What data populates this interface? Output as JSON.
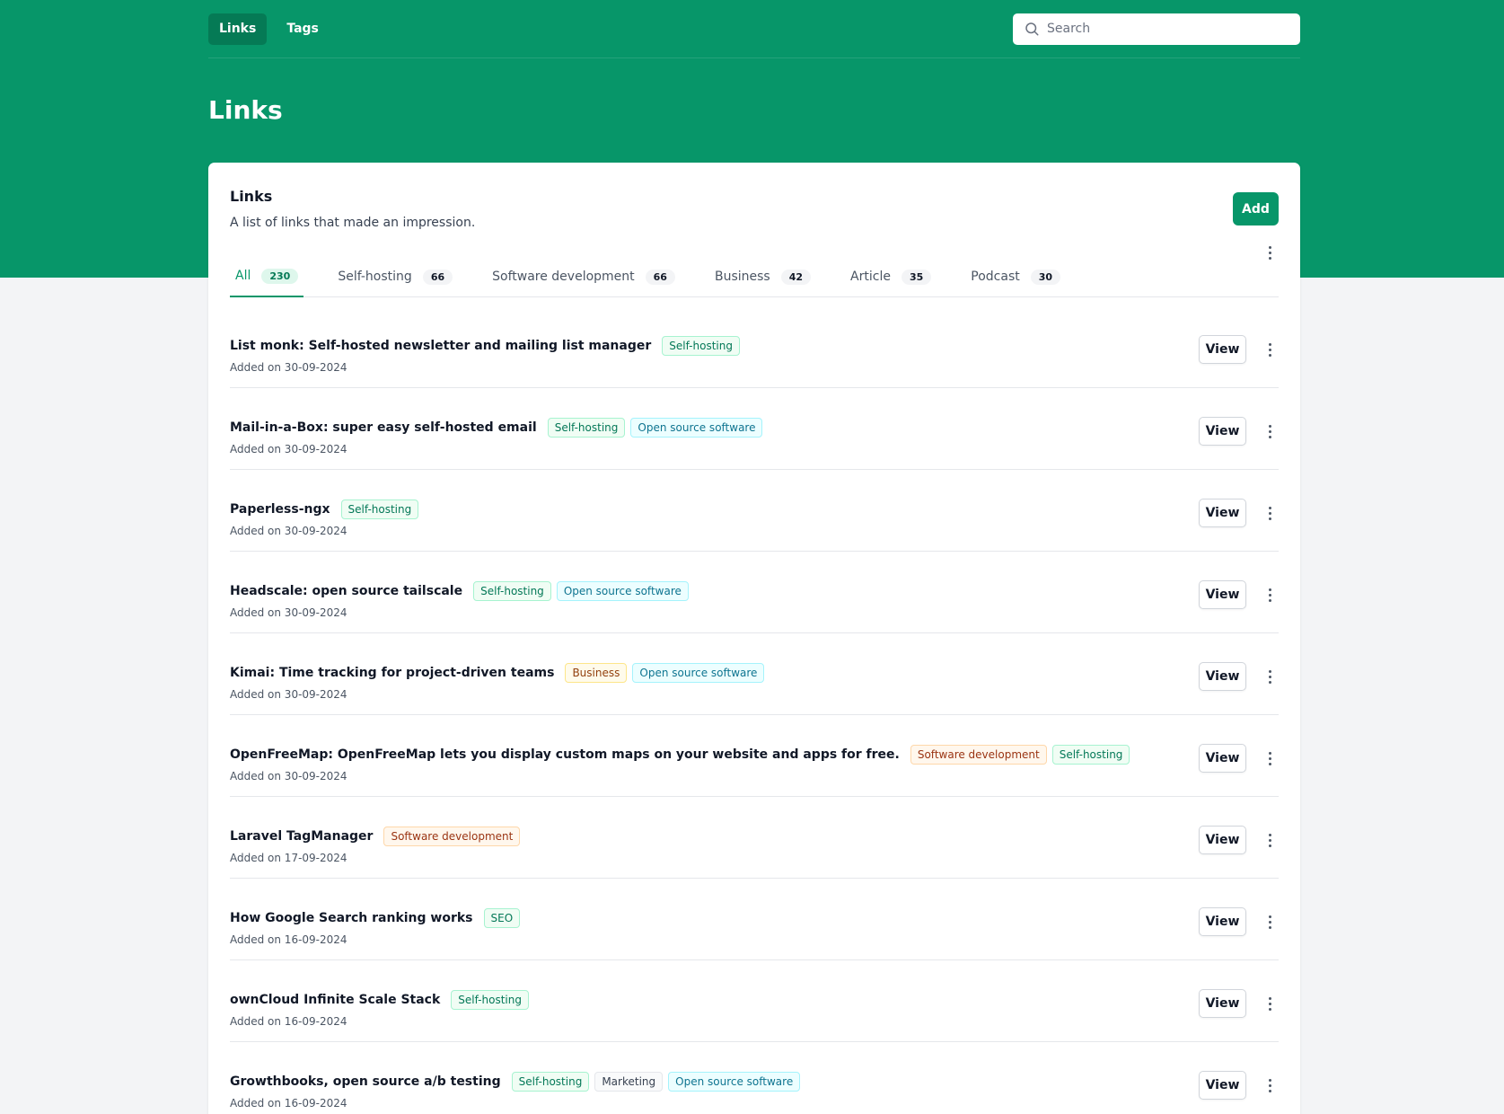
{
  "nav": {
    "items": [
      {
        "label": "Links",
        "active": true
      },
      {
        "label": "Tags",
        "active": false
      }
    ]
  },
  "search": {
    "placeholder": "Search",
    "value": ""
  },
  "page_title": "Links",
  "card": {
    "title": "Links",
    "description": "A list of links that made an impression.",
    "add_label": "Add"
  },
  "tabs": [
    {
      "label": "All",
      "count": "230",
      "active": true
    },
    {
      "label": "Self-hosting",
      "count": "66",
      "active": false
    },
    {
      "label": "Software development",
      "count": "66",
      "active": false
    },
    {
      "label": "Business",
      "count": "42",
      "active": false
    },
    {
      "label": "Article",
      "count": "35",
      "active": false
    },
    {
      "label": "Podcast",
      "count": "30",
      "active": false
    }
  ],
  "view_label": "View",
  "links": [
    {
      "title": "List monk: Self-hosted newsletter and mailing list manager",
      "date": "Added on 30-09-2024",
      "tags": [
        {
          "label": "Self-hosting",
          "color": "green"
        }
      ]
    },
    {
      "title": "Mail-in-a-Box: super easy self-hosted email",
      "date": "Added on 30-09-2024",
      "tags": [
        {
          "label": "Self-hosting",
          "color": "green"
        },
        {
          "label": "Open source software",
          "color": "cyan"
        }
      ]
    },
    {
      "title": "Paperless-ngx",
      "date": "Added on 30-09-2024",
      "tags": [
        {
          "label": "Self-hosting",
          "color": "green"
        }
      ]
    },
    {
      "title": "Headscale: open source tailscale",
      "date": "Added on 30-09-2024",
      "tags": [
        {
          "label": "Self-hosting",
          "color": "green"
        },
        {
          "label": "Open source software",
          "color": "cyan"
        }
      ]
    },
    {
      "title": "Kimai: Time tracking for project-driven teams",
      "date": "Added on 30-09-2024",
      "tags": [
        {
          "label": "Business",
          "color": "amber"
        },
        {
          "label": "Open source software",
          "color": "cyan"
        }
      ]
    },
    {
      "title": "OpenFreeMap: OpenFreeMap lets you display custom maps on your website and apps for free.",
      "date": "Added on 30-09-2024",
      "tags": [
        {
          "label": "Software development",
          "color": "orange"
        },
        {
          "label": "Self-hosting",
          "color": "green"
        }
      ]
    },
    {
      "title": "Laravel TagManager",
      "date": "Added on 17-09-2024",
      "tags": [
        {
          "label": "Software development",
          "color": "orange"
        }
      ]
    },
    {
      "title": "How Google Search ranking works",
      "date": "Added on 16-09-2024",
      "tags": [
        {
          "label": "SEO",
          "color": "green"
        }
      ]
    },
    {
      "title": "ownCloud Infinite Scale Stack",
      "date": "Added on 16-09-2024",
      "tags": [
        {
          "label": "Self-hosting",
          "color": "green"
        }
      ]
    },
    {
      "title": "Growthbooks, open source a/b testing",
      "date": "Added on 16-09-2024",
      "tags": [
        {
          "label": "Self-hosting",
          "color": "green"
        },
        {
          "label": "Marketing",
          "color": "gray"
        },
        {
          "label": "Open source software",
          "color": "cyan"
        }
      ]
    }
  ],
  "colors": {
    "brand": "#079669",
    "brand_dark": "#057a55",
    "background": "#f3f4f6"
  },
  "icons": {
    "search": "search-icon",
    "more": "more-vertical-icon"
  }
}
